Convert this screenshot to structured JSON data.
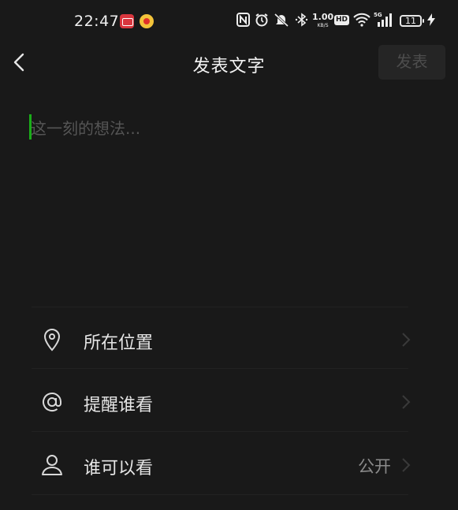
{
  "status_bar": {
    "time": "22:47",
    "net_speed_value": "1.00",
    "net_speed_unit": "KB/S",
    "hd_label": "HD",
    "signal_label": "5G",
    "battery_level": "11"
  },
  "nav": {
    "title": "发表文字",
    "publish_label": "发表"
  },
  "composer": {
    "placeholder": "这一刻的想法..."
  },
  "options": {
    "location_label": "所在位置",
    "mention_label": "提醒谁看",
    "visibility_label": "谁可以看",
    "visibility_value": "公开"
  },
  "colors": {
    "background": "#191919",
    "cursor": "#1aad19",
    "publish_disabled_bg": "#252525",
    "publish_disabled_text": "#4d4d4d"
  }
}
